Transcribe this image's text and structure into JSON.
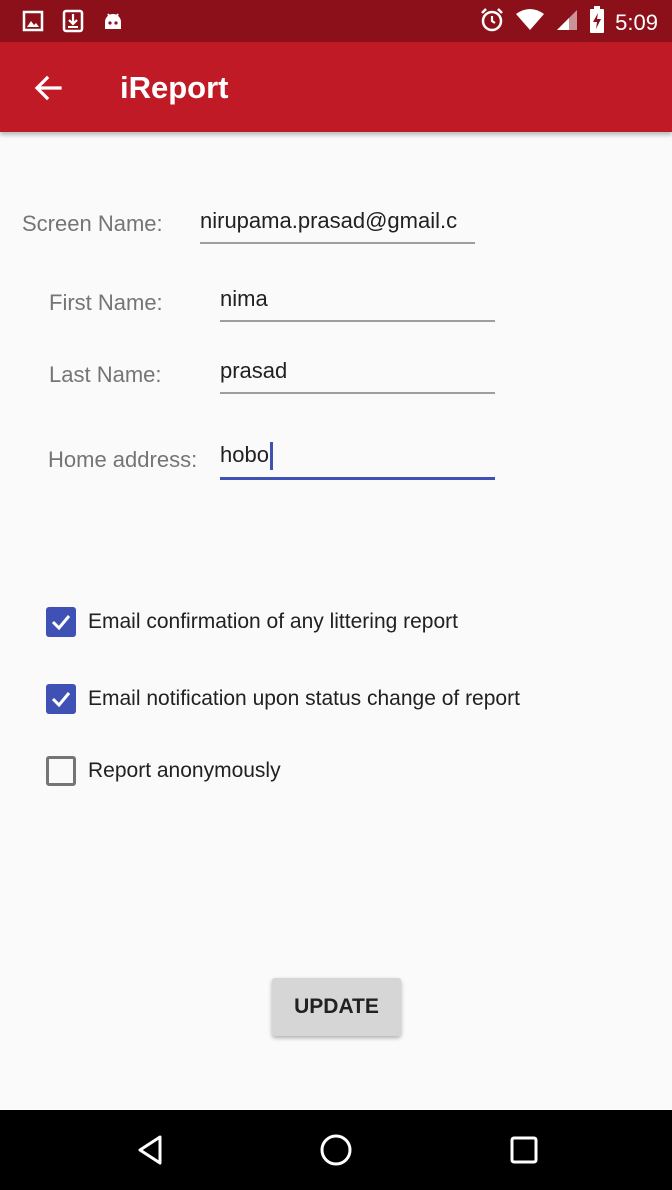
{
  "status_bar": {
    "time": "5:09",
    "bg_color": "#8c1019",
    "left_icons": [
      "image-icon",
      "download-icon",
      "android-icon"
    ],
    "right_icons": [
      "alarm-icon",
      "wifi-icon",
      "signal-icon",
      "battery-charging-icon"
    ]
  },
  "app_bar": {
    "title": "iReport",
    "bg_color": "#c01a27"
  },
  "form": {
    "screen_name": {
      "label": "Screen Name:",
      "value": "nirupama.prasad@gmail.c"
    },
    "first_name": {
      "label": "First Name:",
      "value": "nima"
    },
    "last_name": {
      "label": "Last Name:",
      "value": "prasad"
    },
    "home_address": {
      "label": "Home address:",
      "value": "hobo"
    }
  },
  "checkboxes": [
    {
      "label": "Email confirmation of any littering report",
      "checked": true
    },
    {
      "label": "Email notification upon status change of report",
      "checked": true
    },
    {
      "label": "Report anonymously",
      "checked": false
    }
  ],
  "update_button": {
    "label": "UPDATE"
  },
  "accent_color": "#3f51b5"
}
